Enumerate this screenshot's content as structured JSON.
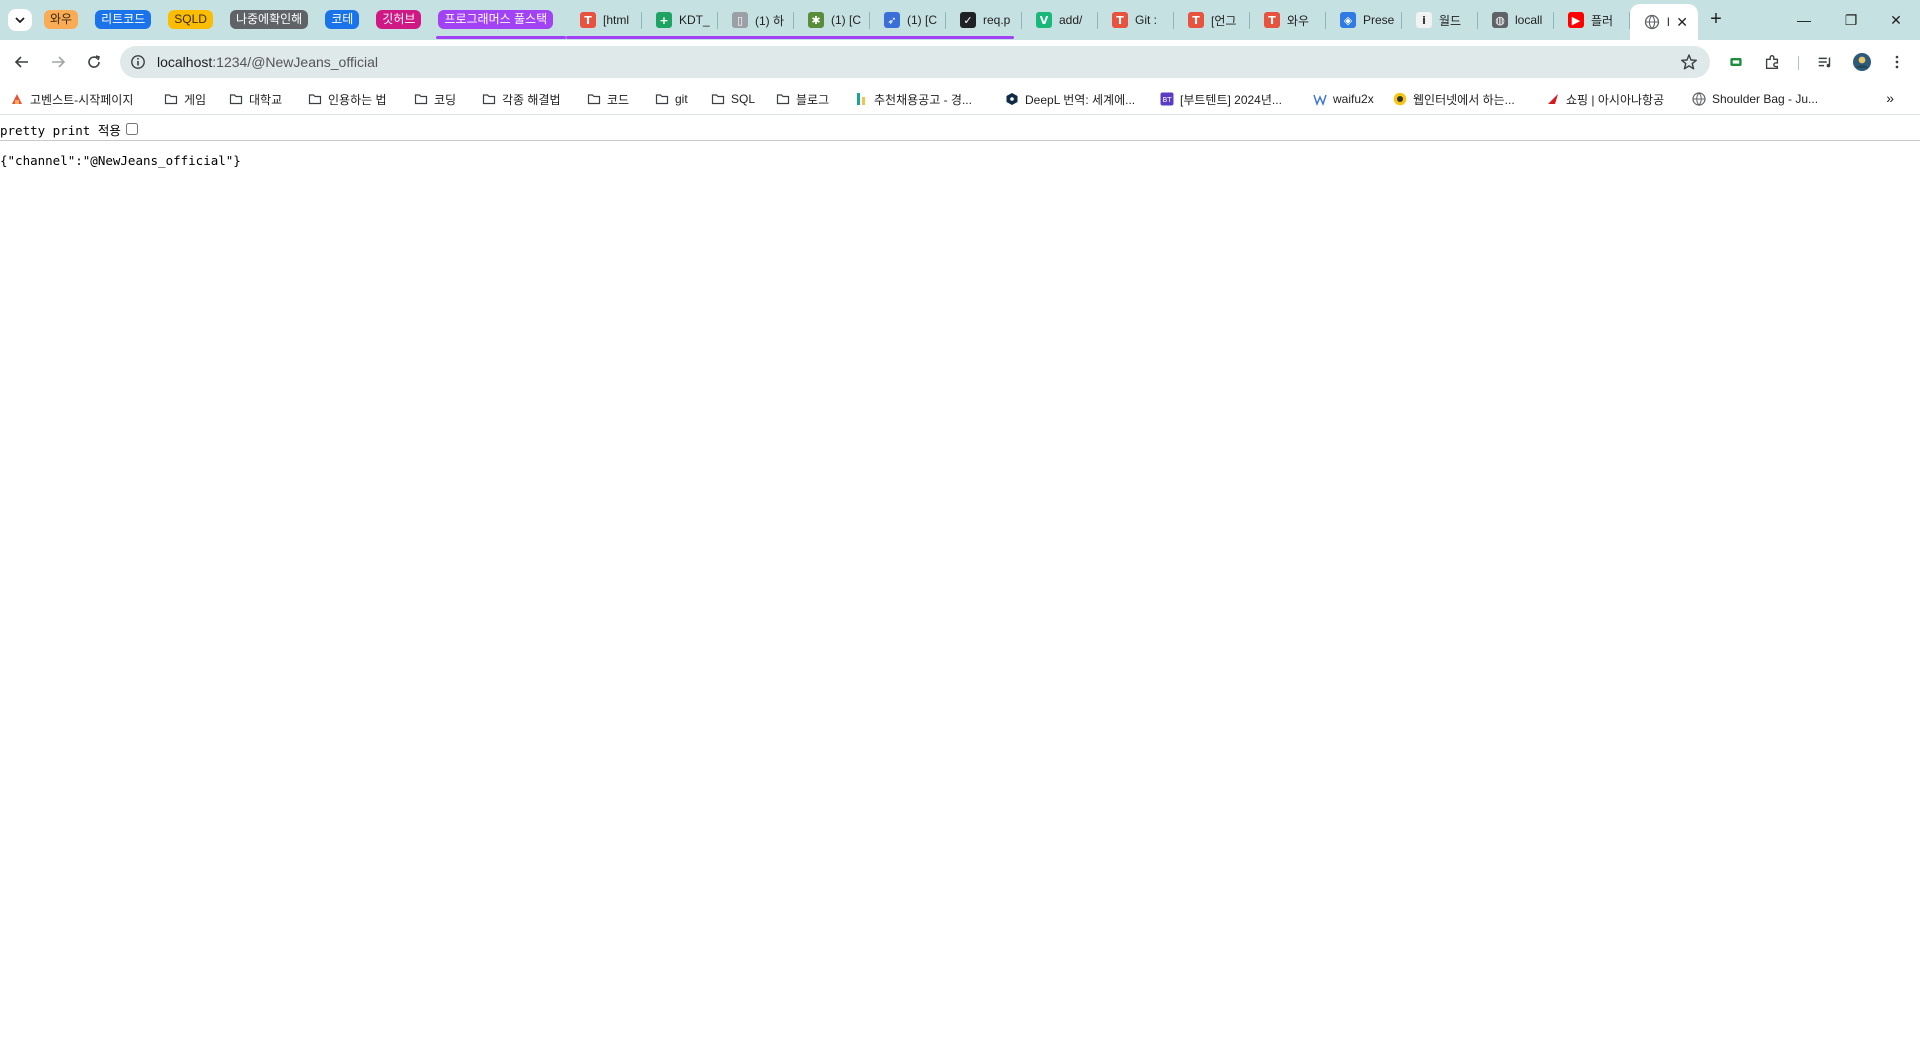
{
  "tab_groups": [
    {
      "label": "와우",
      "color": "#f9ab55",
      "dark": true
    },
    {
      "label": "리트코드",
      "color": "#1a73e8",
      "dark": false
    },
    {
      "label": "SQLD",
      "color": "#fbbc04",
      "dark": true
    },
    {
      "label": "나중에확인해",
      "color": "#5f6368",
      "dark": false
    },
    {
      "label": "코테",
      "color": "#1a73e8",
      "dark": false
    },
    {
      "label": "깃허브",
      "color": "#d01884",
      "dark": false
    },
    {
      "label": "프로그래머스 풀스택",
      "color": "#a142f4",
      "dark": false
    }
  ],
  "tabs": [
    {
      "title": "[html",
      "favicon_color": "#e8533f",
      "glyph": "T"
    },
    {
      "title": "KDT_",
      "favicon_color": "#1ea362",
      "glyph": "+"
    },
    {
      "title": "(1) 하",
      "favicon_color": "#9aa0a6",
      "glyph": "▯"
    },
    {
      "title": "(1) [C",
      "favicon_color": "#5b8c3b",
      "glyph": "✱"
    },
    {
      "title": "(1) [C",
      "favicon_color": "#3b6fd8",
      "glyph": "➶"
    },
    {
      "title": "req.p",
      "favicon_color": "#202124",
      "glyph": "✓"
    },
    {
      "title": "add/",
      "favicon_color": "#18b87a",
      "glyph": "V"
    },
    {
      "title": "Git :",
      "favicon_color": "#e8533f",
      "glyph": "T"
    },
    {
      "title": "[언그",
      "favicon_color": "#e8533f",
      "glyph": "T"
    },
    {
      "title": "와우",
      "favicon_color": "#e8533f",
      "glyph": "T"
    },
    {
      "title": "Prese",
      "favicon_color": "#2f7ae5",
      "glyph": "◈"
    },
    {
      "title": "월드",
      "favicon_color": "#f2f2f2",
      "glyph": "i"
    },
    {
      "title": "locall",
      "favicon_color": "#5f6368",
      "glyph": "◍"
    },
    {
      "title": "플러",
      "favicon_color": "#ff0000",
      "glyph": "▶"
    }
  ],
  "active_tab": {
    "title": "l",
    "close_label": "✕"
  },
  "window": {
    "newtab_label": "+",
    "minimize": "—",
    "restore": "❐",
    "close": "✕"
  },
  "omnibox": {
    "host": "localhost",
    "path": ":1234/@NewJeans_official"
  },
  "bookmarks": [
    {
      "label": "고벤스트-시작페이지",
      "icon": "home-favicon-icon"
    },
    {
      "label": "게임",
      "icon": "folder-icon"
    },
    {
      "label": "대학교",
      "icon": "folder-icon"
    },
    {
      "label": "인용하는 법",
      "icon": "folder-icon"
    },
    {
      "label": "코딩",
      "icon": "folder-icon"
    },
    {
      "label": "각종 해결법",
      "icon": "folder-icon"
    },
    {
      "label": "코드",
      "icon": "folder-icon"
    },
    {
      "label": "git",
      "icon": "folder-icon"
    },
    {
      "label": "SQL",
      "icon": "folder-icon"
    },
    {
      "label": "블로그",
      "icon": "folder-icon"
    },
    {
      "label": "추천채용공고 - 경...",
      "icon": "job-favicon-icon"
    },
    {
      "label": "DeepL 번역: 세계에...",
      "icon": "deepl-favicon-icon"
    },
    {
      "label": "[부트텐트] 2024년...",
      "icon": "bt-favicon-icon"
    },
    {
      "label": "waifu2x",
      "icon": "waifu-favicon-icon"
    },
    {
      "label": "웹인터넷에서 하는...",
      "icon": "smile-favicon-icon"
    },
    {
      "label": "쇼핑 | 아시아나항공",
      "icon": "asiana-favicon-icon"
    },
    {
      "label": "Shoulder Bag - Ju...",
      "icon": "globe-favicon-icon"
    }
  ],
  "bookmarks_overflow": "»",
  "page": {
    "pretty_print_label": "pretty print 적용",
    "json_text": "{\"channel\":\"@NewJeans_official\"}"
  }
}
